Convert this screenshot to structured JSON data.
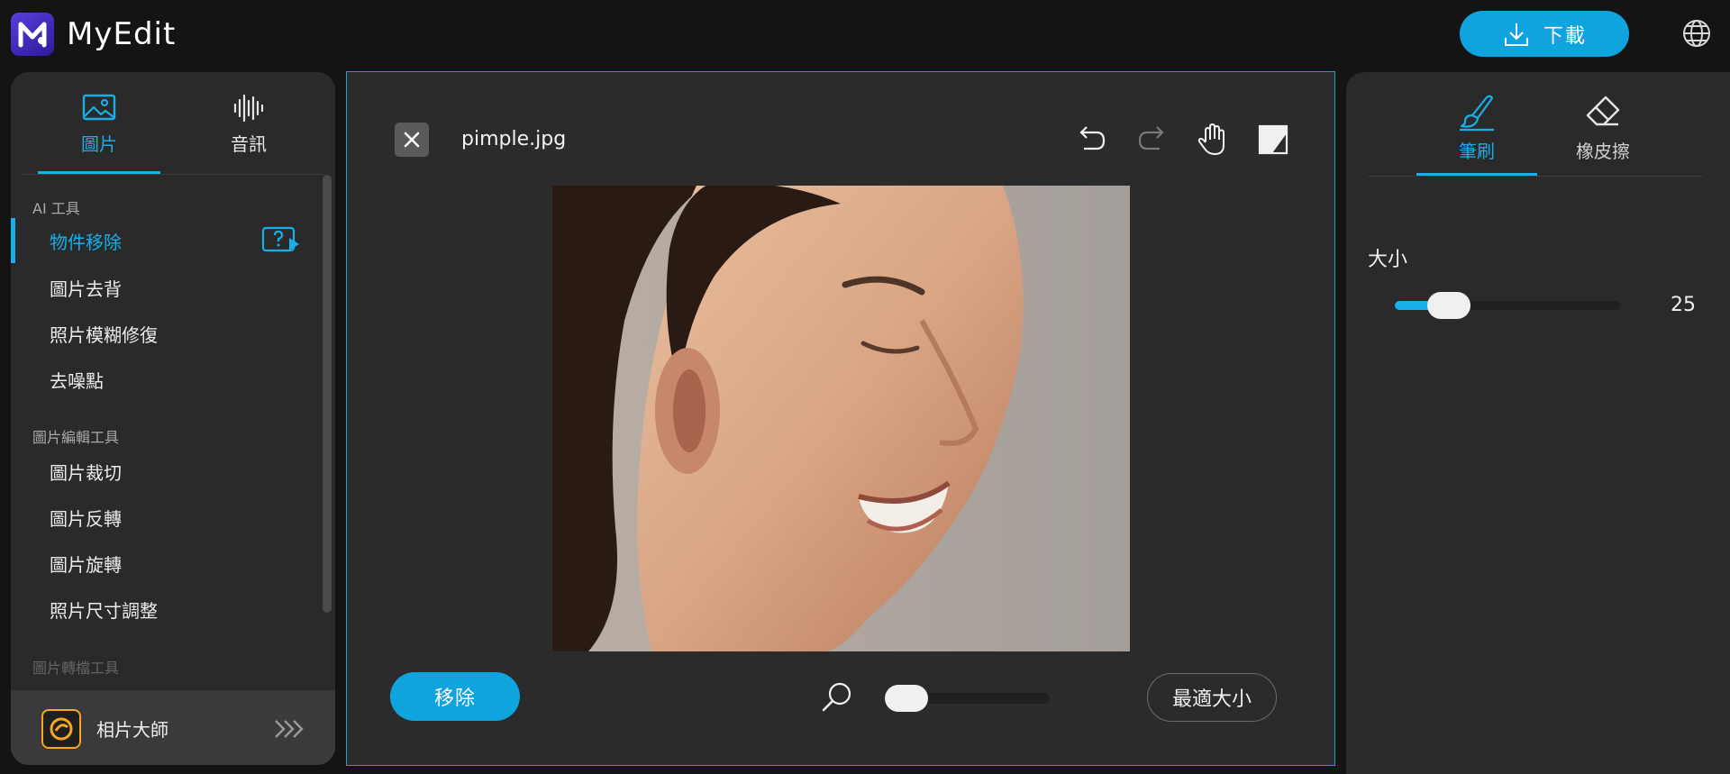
{
  "app": {
    "name": "MyEdit",
    "download_label": "下載"
  },
  "left_panel": {
    "tabs": [
      {
        "label": "圖片",
        "icon": "image-icon",
        "active": true
      },
      {
        "label": "音訊",
        "icon": "audio-wave-icon",
        "active": false
      }
    ],
    "sections": [
      {
        "title": "AI 工具",
        "items": [
          "物件移除",
          "圖片去背",
          "照片模糊修復",
          "去噪點"
        ]
      },
      {
        "title": "圖片編輯工具",
        "items": [
          "圖片裁切",
          "圖片反轉",
          "圖片旋轉",
          "照片尺寸調整"
        ]
      },
      {
        "title": "圖片轉檔工具",
        "items": []
      }
    ],
    "active_item": "物件移除",
    "promo_label": "相片大師"
  },
  "canvas": {
    "filename": "pimple.jpg",
    "tools": [
      "undo-icon",
      "redo-icon",
      "hand-pan-icon",
      "compare-icon"
    ],
    "remove_label": "移除",
    "fit_label": "最適大小",
    "zoom_level": 0.0
  },
  "right_panel": {
    "tabs": [
      {
        "label": "筆刷",
        "icon": "brush-icon",
        "active": true
      },
      {
        "label": "橡皮擦",
        "icon": "eraser-icon",
        "active": false
      }
    ],
    "size_label": "大小",
    "size_value": "25"
  },
  "colors": {
    "accent": "#18aee9",
    "panel": "#2a2a2a",
    "background": "#141414"
  }
}
